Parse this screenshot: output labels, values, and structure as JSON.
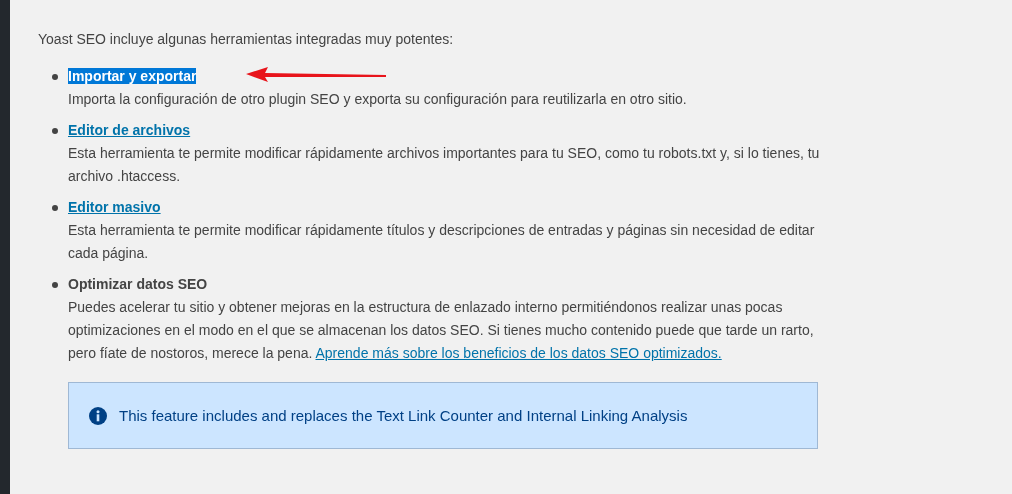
{
  "intro": "Yoast SEO incluye algunas herramientas integradas muy potentes:",
  "tools": [
    {
      "kind": "highlighted",
      "title": "Importar y exportar",
      "description": "Importa la configuración de otro plugin SEO y exporta su configuración para reutilizarla en otro sitio.",
      "arrow": true
    },
    {
      "kind": "link",
      "title": "Editor de archivos",
      "description": "Esta herramienta te permite modificar rápidamente archivos importantes para tu SEO, como tu robots.txt y, si lo tienes, tu archivo .htaccess.",
      "arrow": false
    },
    {
      "kind": "link",
      "title": "Editor masivo",
      "description": "Esta herramienta te permite modificar rápidamente títulos y descripciones de entradas y páginas sin necesidad de editar cada página.",
      "arrow": false
    },
    {
      "kind": "plain",
      "title": "Optimizar datos SEO",
      "description": "Puedes acelerar tu sitio y obtener mejoras en la estructura de enlazado interno permitiéndonos realizar unas pocas optimizaciones en el modo en el que se almacenan los datos SEO. Si tienes mucho contenido puede que tarde un rarto, pero fíate de nostoros, merece la pena.",
      "link": "Aprende más sobre los beneficios de los datos SEO optimizados.",
      "arrow": false
    }
  ],
  "notice": "This feature includes and replaces the Text Link Counter and Internal Linking Analysis"
}
